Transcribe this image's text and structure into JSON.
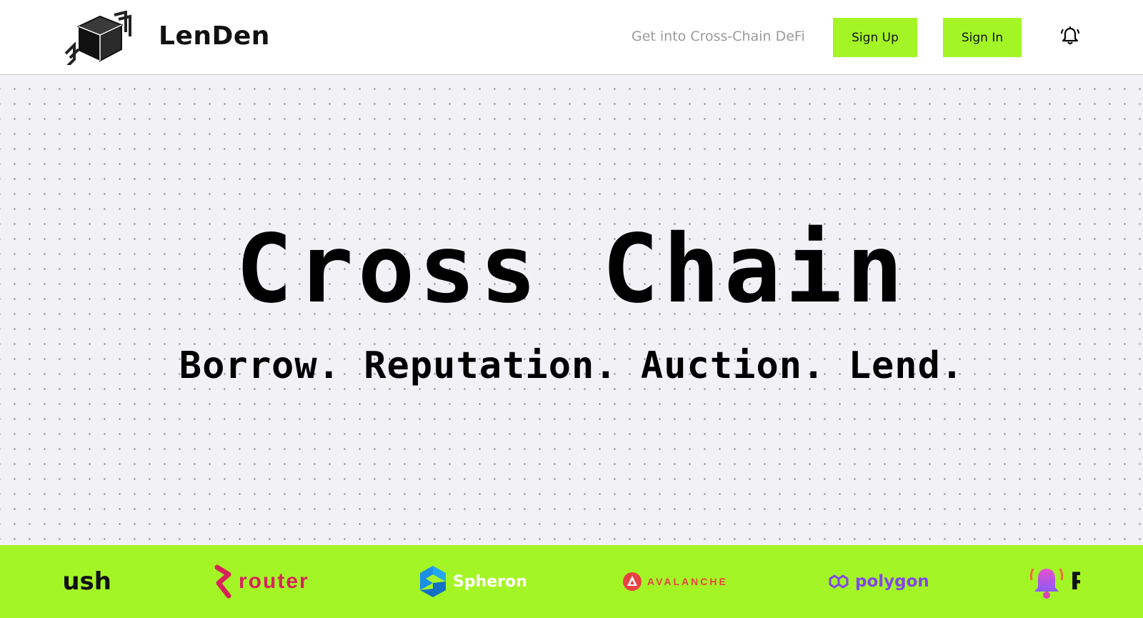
{
  "header": {
    "brand": "LenDen",
    "tagline": "Get into Cross-Chain DeFi",
    "signup_label": "Sign Up",
    "signin_label": "Sign In",
    "logo_icon": "cube-logo-icon",
    "notification_icon": "bell-ringing-icon"
  },
  "hero": {
    "title": "Cross Chain",
    "subtitle": "Borrow. Reputation. Auction. Lend."
  },
  "partners": [
    {
      "name": "Push",
      "visible_text": "ush"
    },
    {
      "name": "router",
      "visible_text": "router"
    },
    {
      "name": "Spheron",
      "visible_text": "Spheron"
    },
    {
      "name": "AVALANCHE",
      "visible_text": "AVALANCHE"
    },
    {
      "name": "polygon",
      "visible_text": "polygon"
    },
    {
      "name": "Push",
      "visible_text": "P"
    }
  ],
  "colors": {
    "accent": "#a4f526",
    "hero_bg": "#f1f1f6",
    "router": "#d6245a",
    "spheron": "#1c8fe6",
    "avalanche": "#e84142",
    "polygon": "#8247e5",
    "push": "#dd44b9"
  }
}
